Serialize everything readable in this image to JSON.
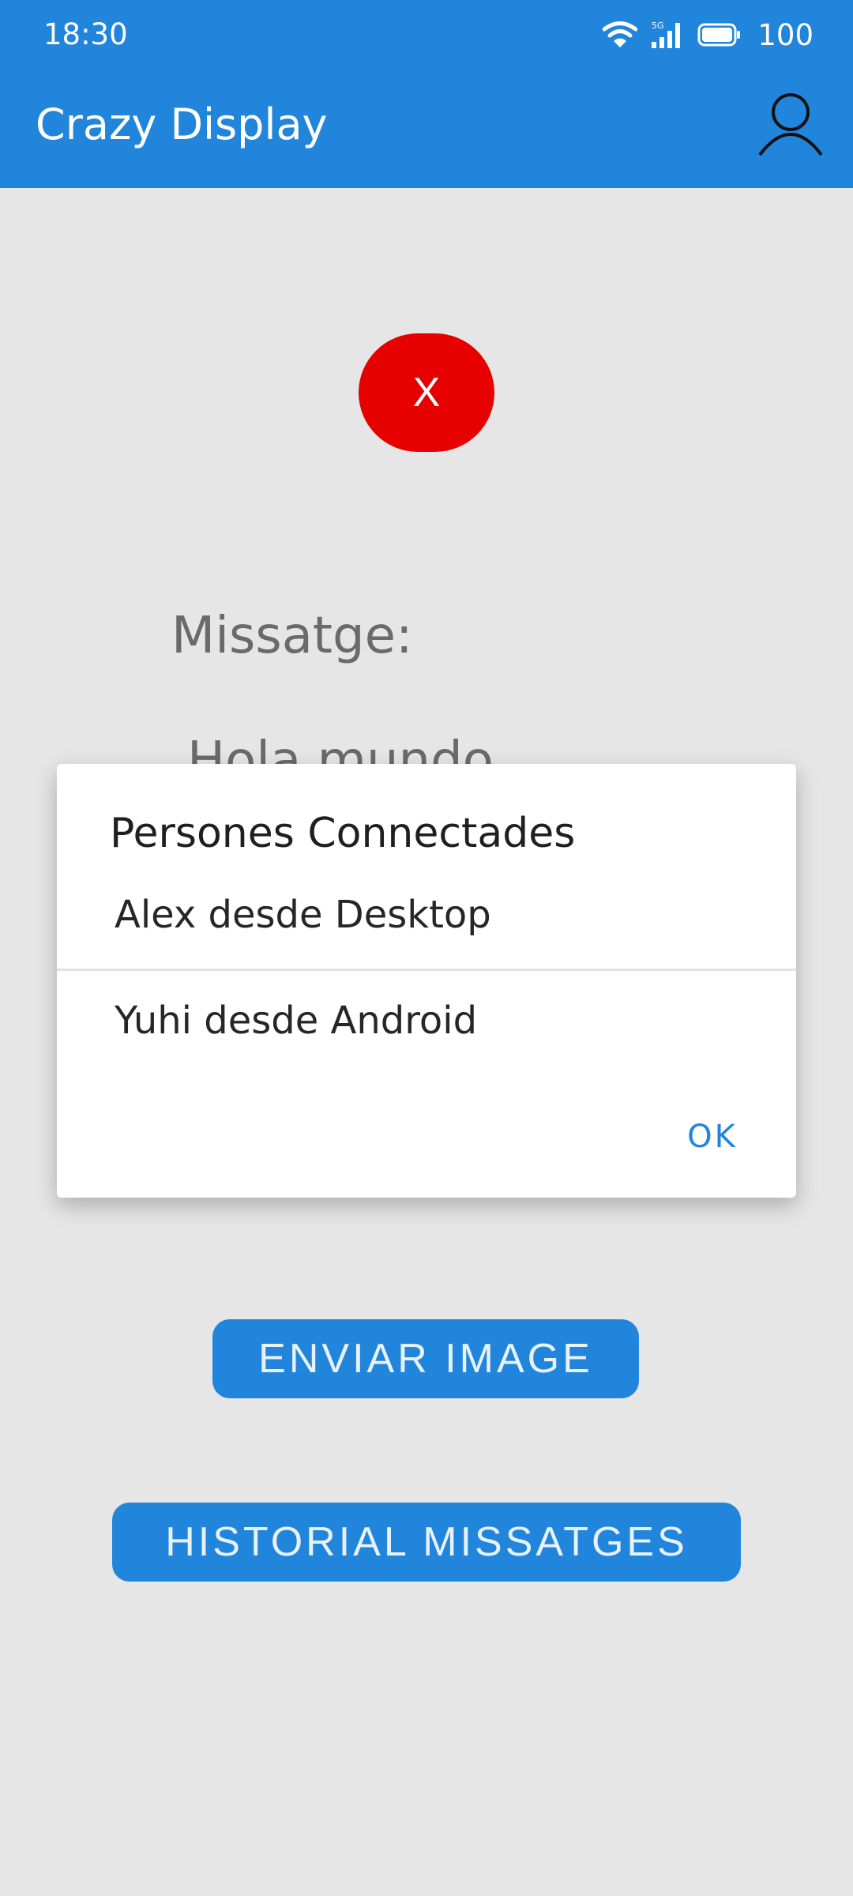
{
  "status_bar": {
    "time": "18:30",
    "network": "5G",
    "battery": "100",
    "icons": [
      "wifi-icon",
      "signal-5g-icon",
      "battery-icon"
    ]
  },
  "app_bar": {
    "title": "Crazy Display",
    "profile_icon": "person-outline-icon",
    "color": "#2185dc"
  },
  "main": {
    "close_button_label": "X",
    "close_button_color": "#e60000",
    "message_label": "Missatge:",
    "message_value": "Hola mundo",
    "send_image_label": "ENVIAR IMAGE",
    "history_label": "HISTORIAL MISSATGES"
  },
  "dialog": {
    "title": "Persones Connectades",
    "items": [
      "Alex desde Desktop",
      "Yuhi desde Android"
    ],
    "ok_label": "OK"
  }
}
